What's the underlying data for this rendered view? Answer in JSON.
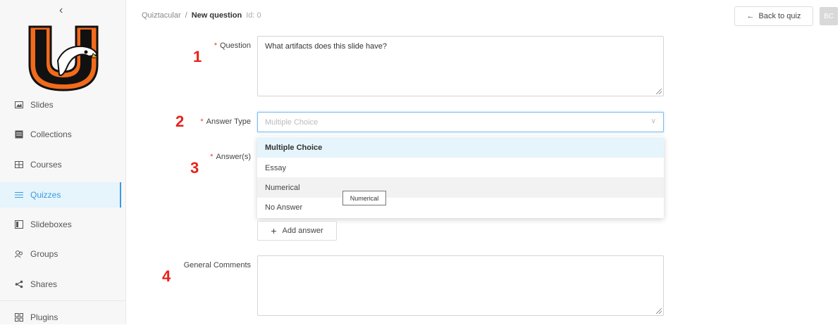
{
  "sidebar": {
    "collapse_icon": "chevron-left-icon",
    "items": [
      {
        "label": "Slides",
        "icon": "image-icon"
      },
      {
        "label": "Collections",
        "icon": "collection-icon"
      },
      {
        "label": "Courses",
        "icon": "table-icon"
      },
      {
        "label": "Quizzes",
        "icon": "list-icon"
      },
      {
        "label": "Slideboxes",
        "icon": "box-icon"
      },
      {
        "label": "Groups",
        "icon": "users-icon"
      },
      {
        "label": "Shares",
        "icon": "share-icon"
      },
      {
        "label": "Plugins",
        "icon": "grid-icon"
      }
    ],
    "active": "Quizzes",
    "accent": "#3a9be0"
  },
  "breadcrumb": {
    "root": "Quiztacular",
    "separator": "/",
    "current": "New question",
    "id_text": "Id: 0"
  },
  "header": {
    "back_label": "Back to quiz",
    "avatar_initials": "BC"
  },
  "form": {
    "question_label": "Question",
    "question_value": "What artifacts does this slide have?",
    "answer_type_label": "Answer Type",
    "answer_type_placeholder": "Multiple Choice",
    "answers_label": "Answer(s)",
    "add_answer_label": "Add answer",
    "general_comments_label": "General Comments",
    "general_comments_value": ""
  },
  "dropdown": {
    "options": [
      "Multiple Choice",
      "Essay",
      "Numerical",
      "No Answer"
    ],
    "selected": "Multiple Choice",
    "hovered": "Numerical",
    "tooltip": "Numerical"
  },
  "annotations": [
    "1",
    "2",
    "3",
    "4"
  ],
  "colors": {
    "required": "#e5403a",
    "annotation": "#e8211b",
    "select_border": "#7fb8e6"
  }
}
